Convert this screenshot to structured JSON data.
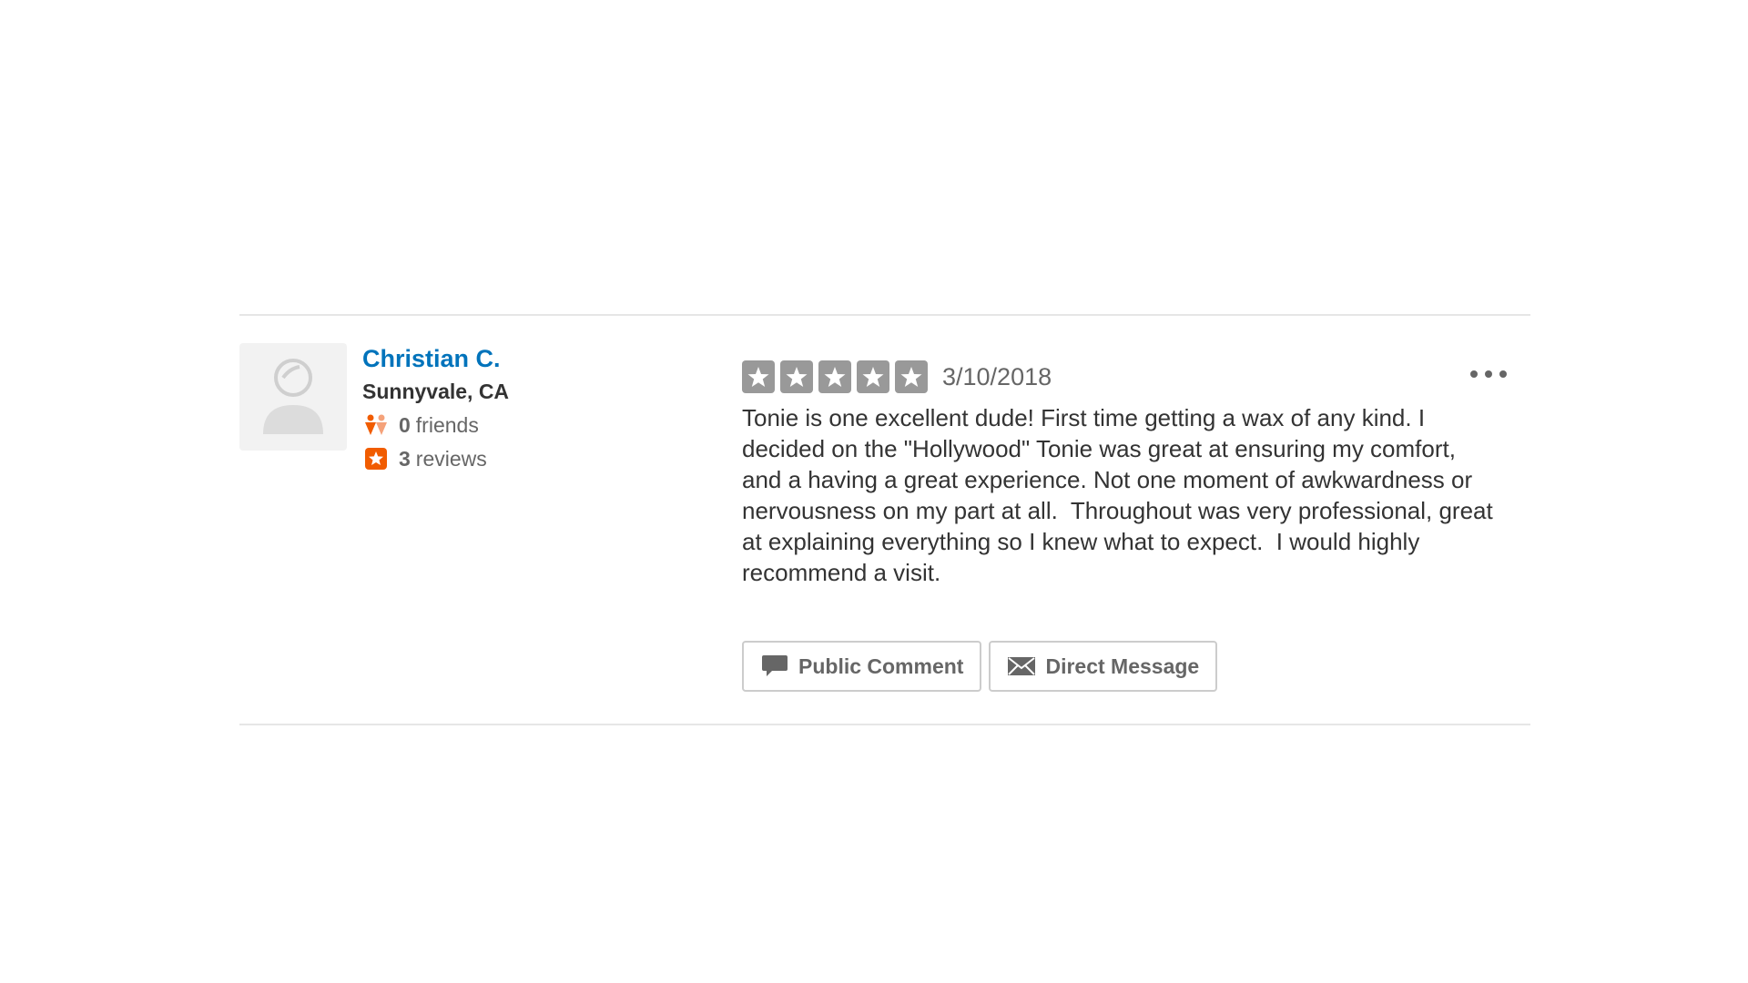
{
  "user": {
    "name": "Christian C.",
    "location": "Sunnyvale, CA",
    "friends_count": "0",
    "friends_label": "friends",
    "reviews_count": "3",
    "reviews_label": "reviews",
    "avatar_icon": "default-user-avatar-icon"
  },
  "review": {
    "rating": 5,
    "rating_max": 5,
    "date": "3/10/2018",
    "text": "Tonie is one excellent dude! First time getting a wax of any kind. I decided on the \"Hollywood\" Tonie was great at ensuring my comfort, and a having a great experience. Not one moment of awkwardness or nervousness on my part at all.  Throughout was very professional, great at explaining everything so I knew what to expect.  I would highly recommend a visit."
  },
  "actions": {
    "public_comment_label": "Public Comment",
    "public_comment_icon": "speech-bubble-icon",
    "direct_message_label": "Direct Message",
    "direct_message_icon": "envelope-icon"
  },
  "colors": {
    "user_link": "#0073bb",
    "star_bg": "#999999",
    "accent_orange": "#f15c00",
    "divider": "#e6e6e6"
  }
}
